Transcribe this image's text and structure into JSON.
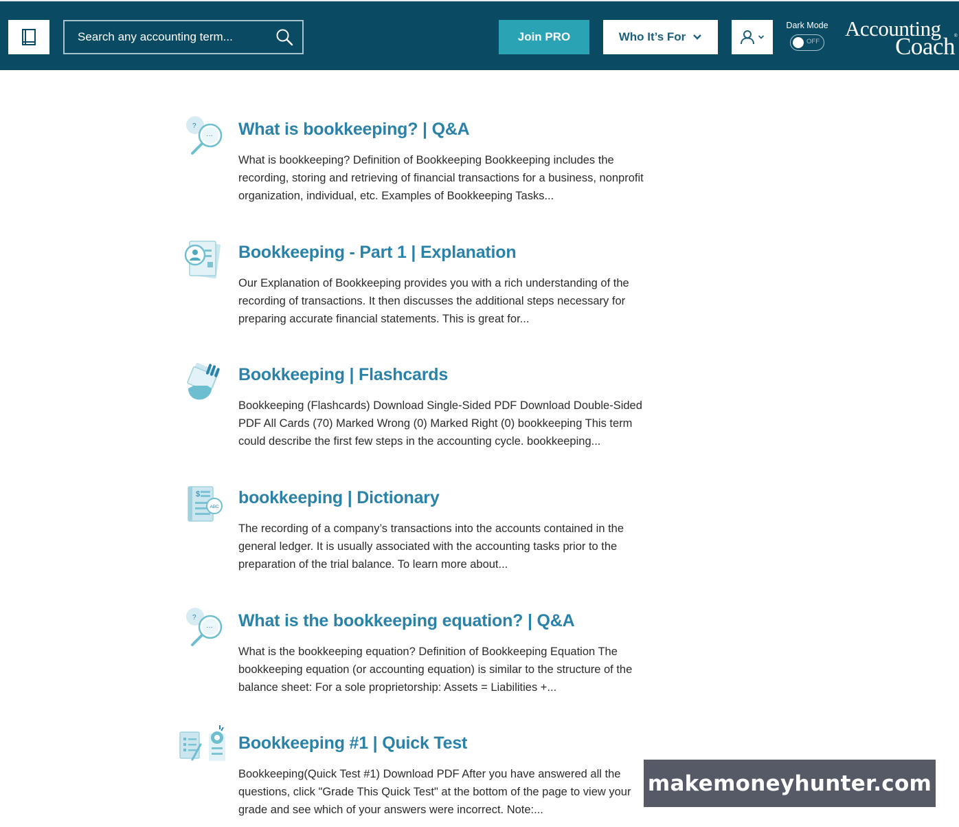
{
  "header": {
    "search_placeholder": "Search any accounting term...",
    "join_label": "Join PRO",
    "who_label": "Who It’s For",
    "dark_mode_label": "Dark Mode",
    "dark_mode_state": "OFF",
    "logo_line1": "Accounting",
    "logo_line2": "Coach",
    "logo_mark": "®",
    "brand_color": "#0b4a63",
    "accent_color": "#2aa3b5"
  },
  "results": [
    {
      "icon": "qa-magnifier-icon",
      "title": "What is bookkeeping? | Q&A",
      "text": "What is bookkeeping? Definition of Bookkeeping Bookkeeping includes the recording, storing and retrieving of financial transactions for a business, nonprofit organization, individual, etc. Examples of Bookkeeping Tasks..."
    },
    {
      "icon": "explanation-document-icon",
      "title": "Bookkeeping - Part 1 | Explanation",
      "text": "Our Explanation of Bookkeeping provides you with a rich understanding of the recording of transactions. It then discusses the additional steps necessary for preparing accurate financial statements. This is great for..."
    },
    {
      "icon": "flashcards-hand-icon",
      "title": "Bookkeeping | Flashcards",
      "text": "Bookkeeping (Flashcards) Download Single-Sided PDF Download Double-Sided PDF All Cards (70) Marked Wrong (0) Marked Right (0) bookkeeping This term could describe the first few steps in the accounting cycle. bookkeeping..."
    },
    {
      "icon": "dictionary-abc-icon",
      "title": "bookkeeping | Dictionary",
      "text": "The recording of a company’s transactions into the accounts contained in the general ledger. It is usually associated with the accounting tasks prior to the preparation of the trial balance. To learn more about..."
    },
    {
      "icon": "qa-magnifier-icon",
      "title": "What is the bookkeeping equation? | Q&A",
      "text": "What is the bookkeeping equation? Definition of Bookkeeping Equation The bookkeeping equation (or accounting equation) is similar to the structure of the balance sheet: For a sole proprietorship: Assets = Liabilities +..."
    },
    {
      "icon": "quick-test-icon",
      "title": "Bookkeeping #1 | Quick Test",
      "text": "Bookkeeping(Quick Test #1) Download PDF After you have answered all the questions, click \"Grade This Quick Test\" at the bottom of the page to view your grade and see which of your answers were incorrect. Note:..."
    }
  ],
  "watermark": "makemoneyhunter.com"
}
